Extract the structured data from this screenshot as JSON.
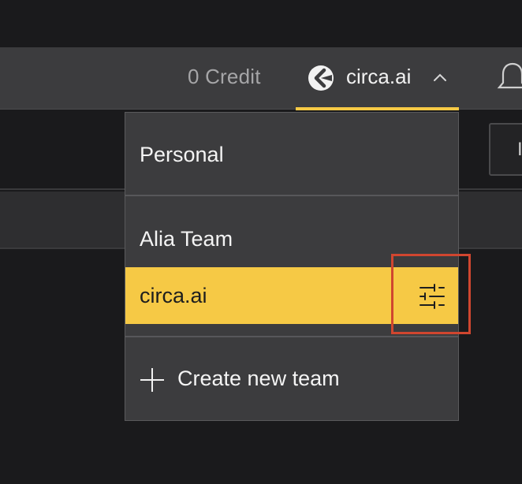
{
  "header": {
    "credit_text": "0 Credit",
    "current_team": "circa.ai",
    "chevron_icon": "chevron-up-icon",
    "bell_icon": "bell-icon",
    "accent_color": "#f6c945"
  },
  "background": {
    "button_text": "I"
  },
  "dropdown": {
    "personal_label": "Personal",
    "teams": [
      {
        "label": "Alia Team",
        "active": false
      },
      {
        "label": "circa.ai",
        "active": true
      }
    ],
    "settings_icon": "sliders-icon",
    "create_label": "Create new team",
    "create_icon": "plus-icon",
    "highlight_color": "#d0462f"
  }
}
